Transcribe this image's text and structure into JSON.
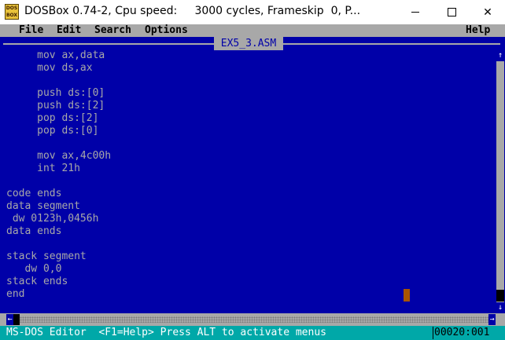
{
  "window": {
    "title": "DOSBox 0.74-2, Cpu speed:     3000 cycles, Frameskip  0, P...",
    "icon_label_top": "DOS",
    "icon_label_bottom": "BOX",
    "minimize": "minimize-icon",
    "maximize": "maximize-icon",
    "close_glyph": "✕"
  },
  "menubar": {
    "file": "File",
    "edit": "Edit",
    "search": "Search",
    "options": "Options",
    "help": "Help"
  },
  "editor": {
    "filename": "EX5_3.ASM",
    "lines": [
      "     mov ax,data",
      "     mov ds,ax",
      "",
      "     push ds:[0]",
      "     push ds:[2]",
      "     pop ds:[2]",
      "     pop ds:[0]",
      "",
      "     mov ax,4c00h",
      "     int 21h",
      "",
      "code ends",
      "data segment",
      " dw 0123h,0456h",
      "data ends",
      "",
      "stack segment",
      "   dw 0,0",
      "stack ends",
      "end"
    ]
  },
  "scrollbars": {
    "up_arrow": "↑",
    "down_arrow": "↓",
    "left_arrow": "←",
    "right_arrow": "→"
  },
  "statusbar": {
    "text": "MS-DOS Editor  <F1=Help> Press ALT to activate menus",
    "position": "00020:001"
  },
  "colors": {
    "dos_background": "#0000a8",
    "text": "#a8a8a8",
    "statusbar": "#00a8a8",
    "cursor": "#a85400"
  }
}
